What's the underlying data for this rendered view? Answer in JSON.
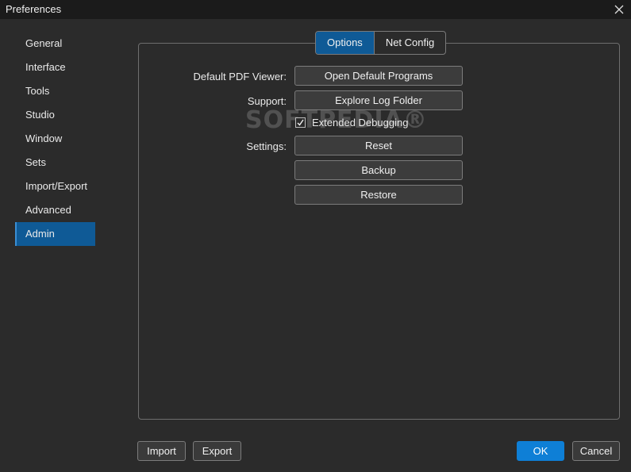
{
  "window": {
    "title": "Preferences",
    "close_icon": "close-icon"
  },
  "sidebar": {
    "items": [
      {
        "label": "General",
        "active": false
      },
      {
        "label": "Interface",
        "active": false
      },
      {
        "label": "Tools",
        "active": false
      },
      {
        "label": "Studio",
        "active": false
      },
      {
        "label": "Window",
        "active": false
      },
      {
        "label": "Sets",
        "active": false
      },
      {
        "label": "Import/Export",
        "active": false
      },
      {
        "label": "Advanced",
        "active": false
      },
      {
        "label": "Admin",
        "active": true
      }
    ]
  },
  "tabs": [
    {
      "label": "Options",
      "active": true
    },
    {
      "label": "Net Config",
      "active": false
    }
  ],
  "options": {
    "default_pdf_viewer_label": "Default PDF Viewer:",
    "open_default_programs_label": "Open Default Programs",
    "support_label": "Support:",
    "explore_log_folder_label": "Explore Log Folder",
    "extended_debugging_label": "Extended Debugging",
    "extended_debugging_checked": true,
    "settings_label": "Settings:",
    "reset_label": "Reset",
    "backup_label": "Backup",
    "restore_label": "Restore"
  },
  "watermark": "SOFTPEDIA®",
  "footer": {
    "import_label": "Import",
    "export_label": "Export",
    "ok_label": "OK",
    "cancel_label": "Cancel"
  },
  "colors": {
    "accent": "#0f5a96",
    "primary_button": "#0e7fd6",
    "background": "#2b2b2b",
    "titlebar": "#1b1b1b"
  }
}
